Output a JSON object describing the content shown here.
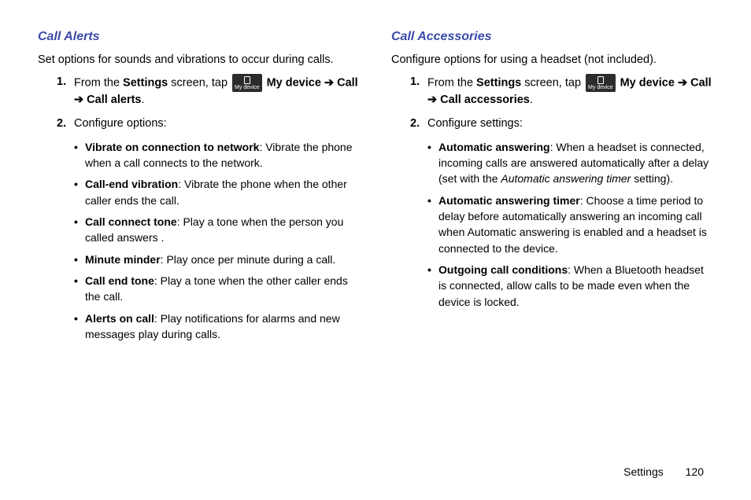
{
  "left": {
    "heading": "Call Alerts",
    "intro": "Set options for sounds and vibrations to occur during calls.",
    "step1_num": "1.",
    "step1_p1": "From the ",
    "step1_settings": "Settings",
    "step1_p2": " screen, tap ",
    "step1_icon": "My device",
    "step1_mydevice": " My device ",
    "step1_arrow1": "➔",
    "step1_call": " Call ",
    "step1_arrow2": "➔",
    "step1_callalerts": " Call alerts",
    "step1_period": ".",
    "step2_num": "2.",
    "step2_text": "Configure options:",
    "b1_title": "Vibrate on connection to network",
    "b1_text": ": Vibrate the phone when a call connects to the network.",
    "b2_title": "Call-end vibration",
    "b2_text": ": Vibrate the phone when the other caller ends the call.",
    "b3_title": "Call connect tone",
    "b3_text": ": Play a tone when the person you called answers .",
    "b4_title": "Minute minder",
    "b4_text": ": Play once per minute during a call.",
    "b5_title": "Call end tone",
    "b5_text": ": Play a tone when the other caller ends the call.",
    "b6_title": "Alerts on call",
    "b6_text": ": Play notifications for alarms and new messages play during calls."
  },
  "right": {
    "heading": "Call Accessories",
    "intro": "Configure options for using a headset (not included).",
    "step1_num": "1.",
    "step1_p1": "From the ",
    "step1_settings": "Settings",
    "step1_p2": " screen, tap ",
    "step1_icon": "My device",
    "step1_mydevice": " My device ",
    "step1_arrow1": "➔",
    "step1_call": " Call ",
    "step1_arrow2": "➔",
    "step1_callacc": " Call accessories",
    "step1_period": ".",
    "step2_num": "2.",
    "step2_text": "Configure settings:",
    "b1_title": "Automatic answering",
    "b1_text1": ": When a headset is connected, incoming calls are answered automatically after a delay (set with the ",
    "b1_italic": "Automatic answering timer",
    "b1_text2": " setting).",
    "b2_title": "Automatic answering timer",
    "b2_text": ": Choose a time period to delay before automatically answering an incoming call when Automatic answering is enabled and a headset is connected to the device.",
    "b3_title": "Outgoing call conditions",
    "b3_text": ": When a Bluetooth headset is connected, allow calls to be made even when the device is locked."
  },
  "footer": {
    "section": "Settings",
    "page": "120"
  }
}
